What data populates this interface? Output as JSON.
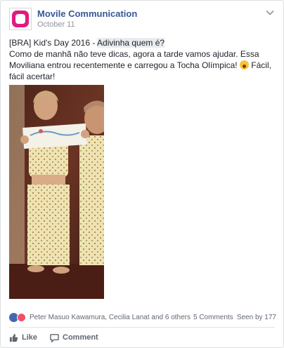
{
  "post": {
    "page_name": "Movile Communication",
    "date": "October 11",
    "text": {
      "prefix": "[BRA] Kid's Day 2016 - ",
      "highlight": "Adivinha quem é?",
      "body": "Como de manhã não teve dicas, agora a tarde vamos ajudar. Essa Moviliana entrou recentemente e carregou a Tocha Olímpica!",
      "suffix": " Fácil, fácil acertar!"
    },
    "photo_alt": "Vintage photo of children in pajamas holding a drawing"
  },
  "reactions": {
    "names": "Peter Masuo Kawamura, Cecilia Lanat and 6 others",
    "comments": "5 Comments",
    "seen": "Seen by 177"
  },
  "actions": {
    "like_label": "Like",
    "comment_label": "Comment"
  },
  "colors": {
    "link": "#365899",
    "brand": "#e3197d",
    "muted": "#90949c"
  }
}
